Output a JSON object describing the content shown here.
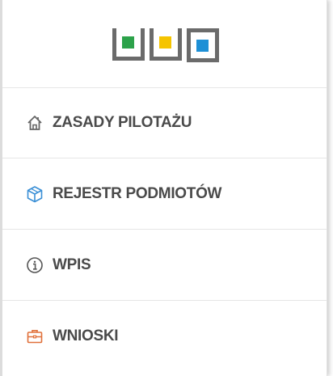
{
  "logo": {
    "colors": [
      "#2ca24a",
      "#f5c400",
      "#1e90d6"
    ],
    "frame_color": "#6b6b6b"
  },
  "menu": {
    "items": [
      {
        "label": "ZASADY PILOTAŻU",
        "icon": "home-icon",
        "icon_color": "#666666"
      },
      {
        "label": "REJESTR PODMIOTÓW",
        "icon": "cube-icon",
        "icon_color": "#3a8fd6"
      },
      {
        "label": "WPIS",
        "icon": "info-icon",
        "icon_color": "#555555"
      },
      {
        "label": "WNIOSKI",
        "icon": "briefcase-icon",
        "icon_color": "#e0703a"
      }
    ]
  }
}
